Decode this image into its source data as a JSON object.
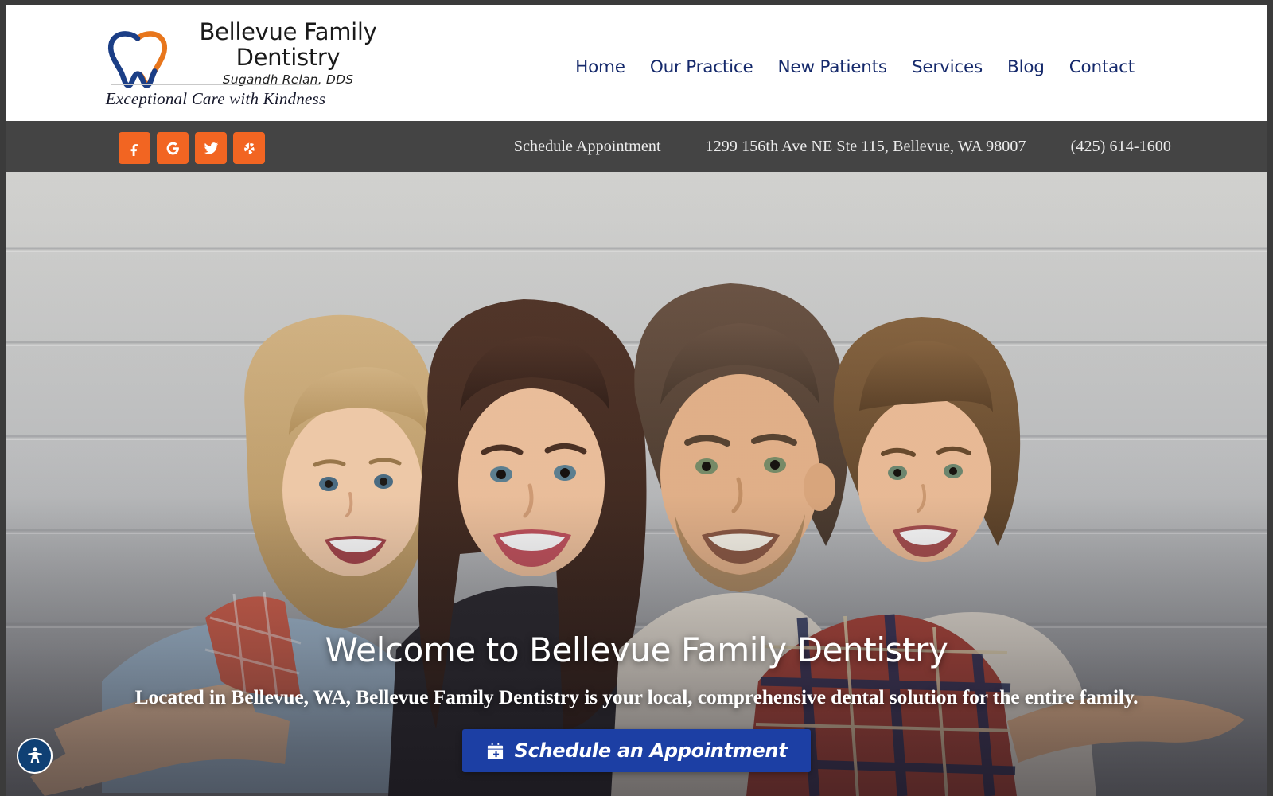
{
  "brand": {
    "logo_icon": "tooth-icon",
    "name_line": "Bellevue Family Dentistry",
    "doctor": "Sugandh Relan, DDS",
    "tagline": "Exceptional Care with Kindness",
    "navy": "#15296b",
    "orange": "#F26522",
    "cta_blue": "#1c3FA4",
    "utilbar_bg": "#444444"
  },
  "nav": {
    "items": [
      {
        "label": "Home"
      },
      {
        "label": "Our Practice"
      },
      {
        "label": "New Patients"
      },
      {
        "label": "Services"
      },
      {
        "label": "Blog"
      },
      {
        "label": "Contact"
      }
    ]
  },
  "utilbar": {
    "socials": [
      {
        "name": "facebook-icon",
        "label": "Facebook"
      },
      {
        "name": "google-icon",
        "label": "Google"
      },
      {
        "name": "twitter-icon",
        "label": "Twitter"
      },
      {
        "name": "yelp-icon",
        "label": "Yelp"
      }
    ],
    "schedule_link": "Schedule Appointment",
    "address": "1299 156th Ave NE Ste 115, Bellevue, WA 98007",
    "phone": "(425) 614-1600"
  },
  "hero": {
    "title": "Welcome to Bellevue Family Dentistry",
    "subtitle": "Located in Bellevue, WA, Bellevue Family Dentistry is your local, comprehensive dental solution for the entire family.",
    "cta_label": "Schedule an Appointment",
    "cta_icon": "calendar-plus-icon",
    "image_alt": "Smiling family of four leaning together against a grey wood plank wall"
  },
  "accessibility": {
    "widget_icon": "accessibility-icon",
    "label": "Accessibility Options"
  }
}
